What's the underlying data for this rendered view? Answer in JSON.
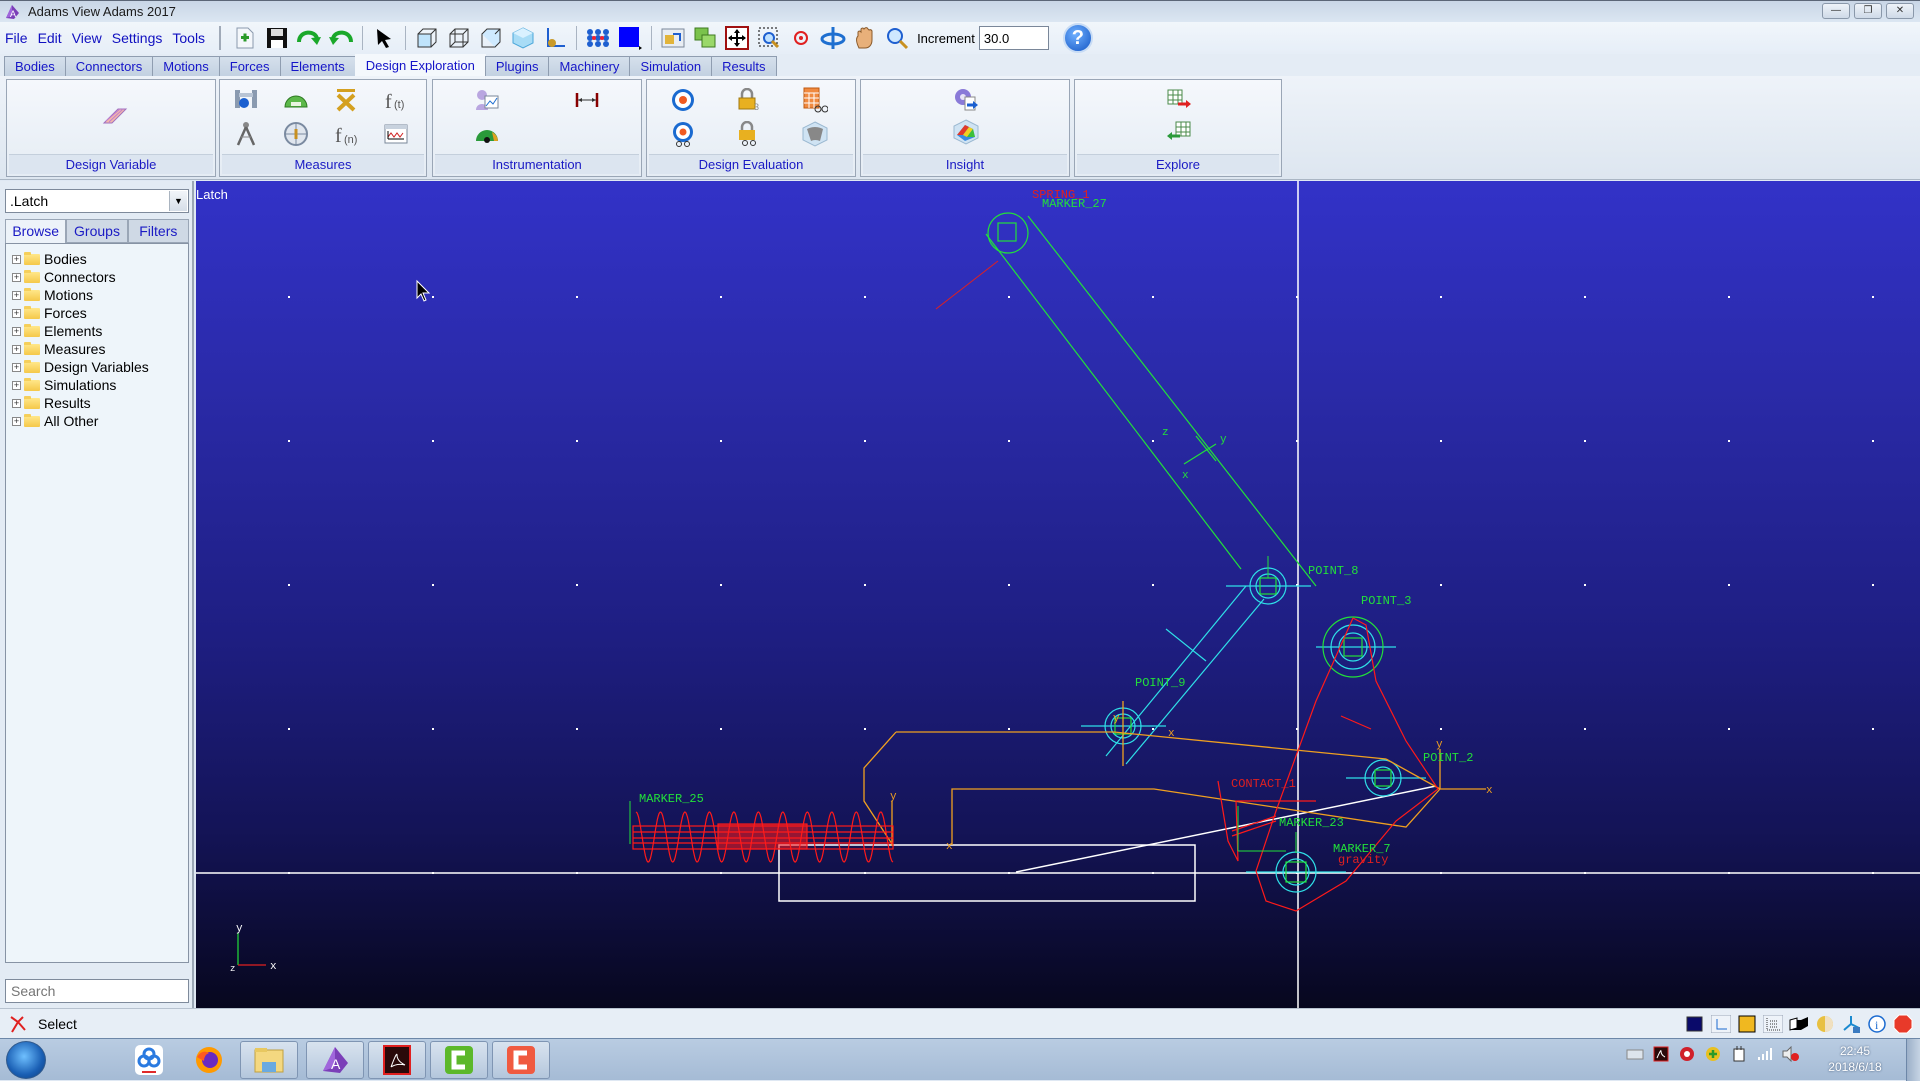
{
  "window": {
    "title": "Adams View Adams 2017",
    "controls": {
      "minimize": "—",
      "restore": "❐",
      "close": "✕"
    }
  },
  "menu": [
    {
      "label": "File",
      "mnemonic": "F"
    },
    {
      "label": "Edit",
      "mnemonic": "E"
    },
    {
      "label": "View",
      "mnemonic": "V"
    },
    {
      "label": "Settings",
      "mnemonic": ""
    },
    {
      "label": "Tools",
      "mnemonic": "T"
    }
  ],
  "toolbar": {
    "buttons": [
      "new-model-icon",
      "save-icon",
      "undo-icon",
      "redo-icon",
      "select-arrow-icon",
      "render-solid-icon",
      "render-wireframe-icon",
      "render-shaded-icon",
      "iso-view-icon",
      "working-grid-icon",
      "icon-visibility-icon",
      "background-color-icon",
      "toggle-view-icon",
      "view-layout-icon",
      "fit-view-icon",
      "zoom-box-icon",
      "center-icon",
      "rotate-icon",
      "pan-hand-icon",
      "zoom-icon"
    ],
    "increment_label": "Increment",
    "increment_value": "30.0",
    "help_label": "?"
  },
  "ribbon_tabs": [
    {
      "label": "Bodies",
      "active": false
    },
    {
      "label": "Connectors",
      "active": false
    },
    {
      "label": "Motions",
      "active": false
    },
    {
      "label": "Forces",
      "active": false
    },
    {
      "label": "Elements",
      "active": false
    },
    {
      "label": "Design Exploration",
      "active": true
    },
    {
      "label": "Plugins",
      "active": false
    },
    {
      "label": "Machinery",
      "active": false
    },
    {
      "label": "Simulation",
      "active": false
    },
    {
      "label": "Results",
      "active": false
    }
  ],
  "ribbon_groups": [
    {
      "label": "Design Variable",
      "icons": [
        "design-variable-icon"
      ]
    },
    {
      "label": "Measures",
      "icons": [
        "point-measure-icon",
        "angle-measure-icon",
        "range-measure-icon",
        "function-time-icon",
        "distance-measure-icon",
        "orientation-measure-icon",
        "function-run-icon",
        "strip-chart-icon"
      ]
    },
    {
      "label": "Instrumentation",
      "icons": [
        "instrument-model-icon",
        "dimension-icon",
        "gauge-icon"
      ]
    },
    {
      "label": "Design Evaluation",
      "icons": [
        "design-objective-icon",
        "design-constraint-icon",
        "table-evaluation-icon",
        "objective-filter-icon",
        "constraint-filter-icon",
        "surface-plot-icon"
      ]
    },
    {
      "label": "Insight",
      "icons": [
        "insight-export-icon",
        "response-surface-icon"
      ]
    },
    {
      "label": "Explore",
      "icons": [
        "explore-export-icon",
        "explore-import-icon"
      ]
    }
  ],
  "left_panel": {
    "model_selector": ".Latch",
    "tabs": [
      {
        "label": "Browse",
        "active": true
      },
      {
        "label": "Groups",
        "active": false
      },
      {
        "label": "Filters",
        "active": false
      }
    ],
    "tree": [
      "Bodies",
      "Connectors",
      "Motions",
      "Forces",
      "Elements",
      "Measures",
      "Design Variables",
      "Simulations",
      "Results",
      "All Other"
    ],
    "search_placeholder": "Search"
  },
  "viewport": {
    "model_name": "Latch",
    "labels": {
      "spring": "SPRING_1",
      "marker27": "MARKER_27",
      "point8": "POINT_8",
      "point3": "POINT_3",
      "point9": "POINT_9",
      "point2": "POINT_2",
      "contact": "CONTACT_1",
      "marker23": "MARKER_23",
      "marker7": "MARKER_7",
      "marker25": "MARKER_25",
      "gravity": "gravity"
    },
    "triad": {
      "y": "y",
      "x": "x",
      "z": "z"
    },
    "colors": {
      "link_green": "#22e03a",
      "link_cyan": "#2fe0e8",
      "latch_orange": "#f0a020",
      "spring_red": "#ff1a1a",
      "ground_white": "#ffffff"
    }
  },
  "status": {
    "text": "Select",
    "tools": [
      "background-color-icon",
      "triad-icon",
      "render-color-icon",
      "grid-icon",
      "shading-icon",
      "sphere-icon",
      "coordinate-icon",
      "info-icon",
      "stop-icon"
    ]
  },
  "taskbar": {
    "apps": [
      "baidu-netdisk-icon",
      "firefox-icon",
      "file-explorer-icon",
      "adams-icon",
      "acrobat-icon",
      "camtasia-green-icon",
      "camtasia-red-icon"
    ],
    "tray": [
      "keyboard-icon",
      "acrobat-tray-icon",
      "security-icon",
      "update-icon",
      "power-icon",
      "network-icon",
      "volume-muted-icon"
    ],
    "time": "22:45",
    "date": "2018/6/18"
  }
}
